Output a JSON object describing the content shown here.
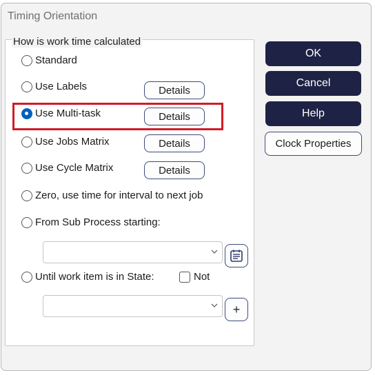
{
  "window": {
    "title": "Timing Orientation"
  },
  "group": {
    "legend": "How is work time calculated",
    "options": [
      {
        "label": "Standard",
        "checked": false
      },
      {
        "label": "Use Labels",
        "checked": false
      },
      {
        "label": "Use Multi-task",
        "checked": true
      },
      {
        "label": "Use Jobs Matrix",
        "checked": false
      },
      {
        "label": "Use Cycle Matrix",
        "checked": false
      },
      {
        "label": "Zero, use time for interval to next job",
        "checked": false
      },
      {
        "label": "From Sub Process starting:",
        "checked": false
      },
      {
        "label": "Until work item is in State:",
        "checked": false
      }
    ],
    "details_label": "Details",
    "not_label": "Not",
    "not_checked": false,
    "sub_process_value": "",
    "state_value": "",
    "add_symbol": "+"
  },
  "buttons": {
    "ok": "OK",
    "cancel": "Cancel",
    "help": "Help",
    "clock_properties": "Clock Properties"
  },
  "colors": {
    "dark_button": "#1e2244",
    "highlight": "#d01b27",
    "radio_selected": "#0060c0"
  }
}
